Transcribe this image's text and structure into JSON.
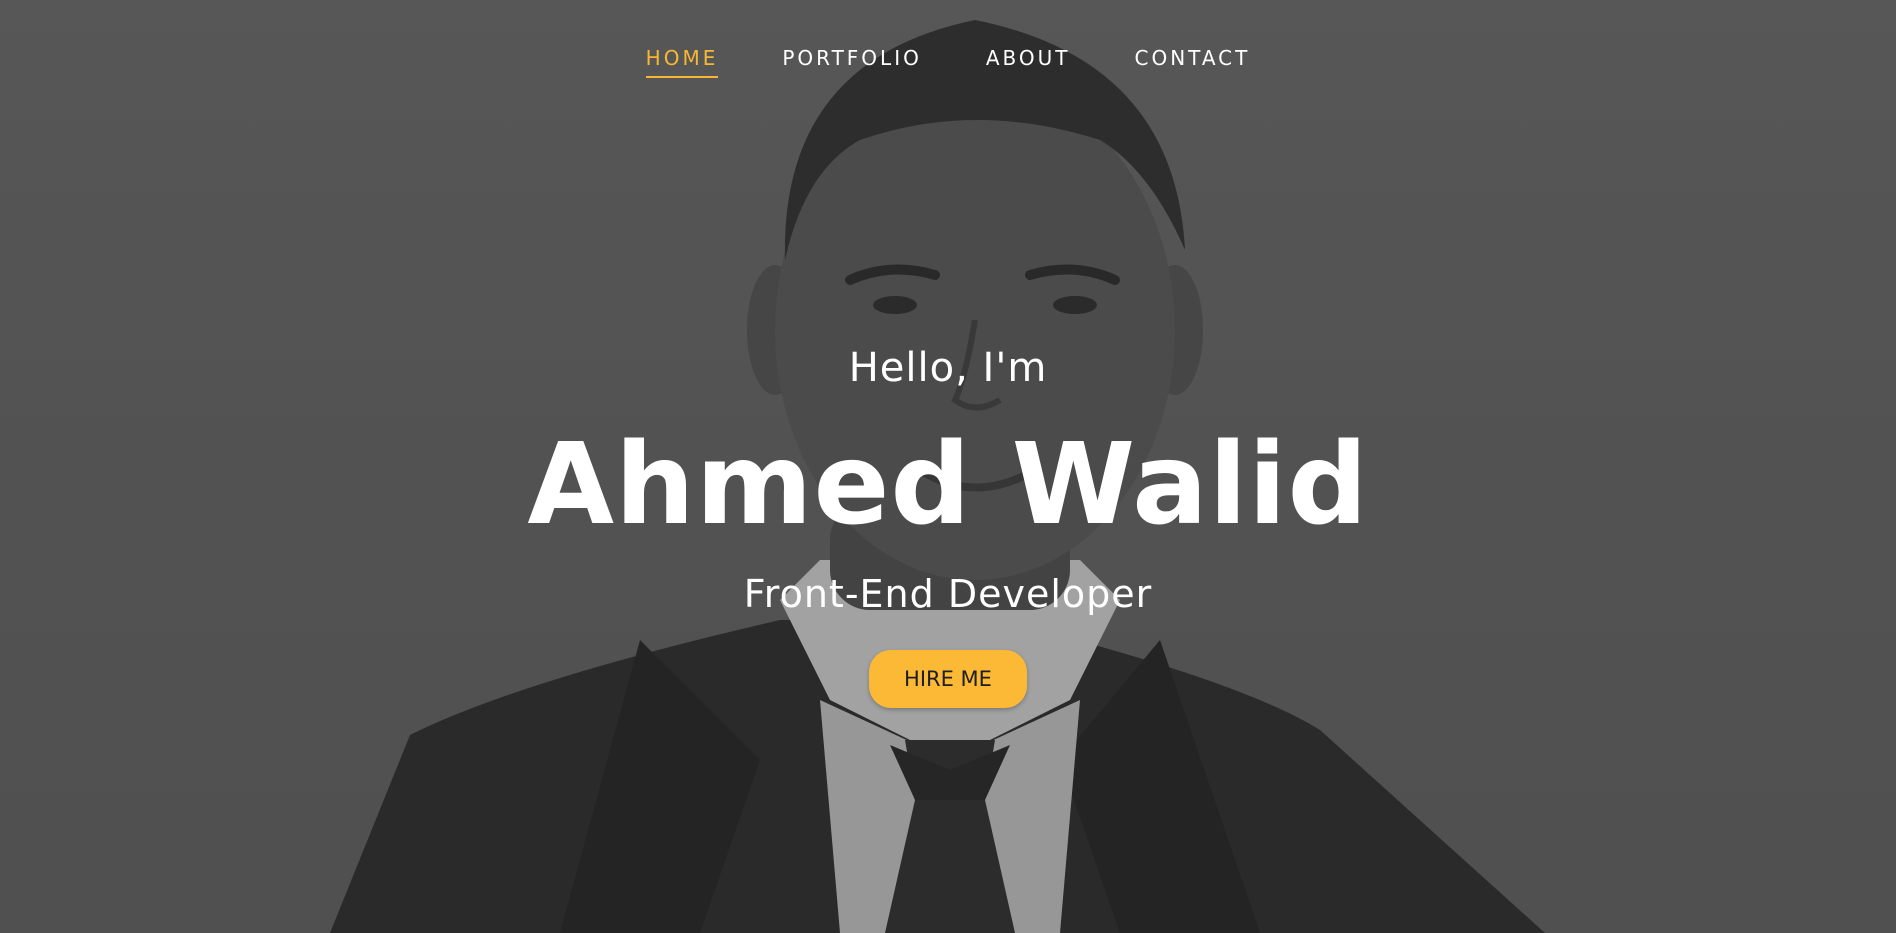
{
  "nav": {
    "items": [
      {
        "label": "HOME",
        "active": true
      },
      {
        "label": "PORTFOLIO",
        "active": false
      },
      {
        "label": "ABOUT",
        "active": false
      },
      {
        "label": "CONTACT",
        "active": false
      }
    ]
  },
  "hero": {
    "greeting": "Hello, I'm",
    "name": "Ahmed Walid",
    "role": "Front-End Developer",
    "cta_label": "HIRE ME"
  },
  "colors": {
    "accent": "#fbb935",
    "text": "#ffffff",
    "background": "#5e5e5e"
  }
}
